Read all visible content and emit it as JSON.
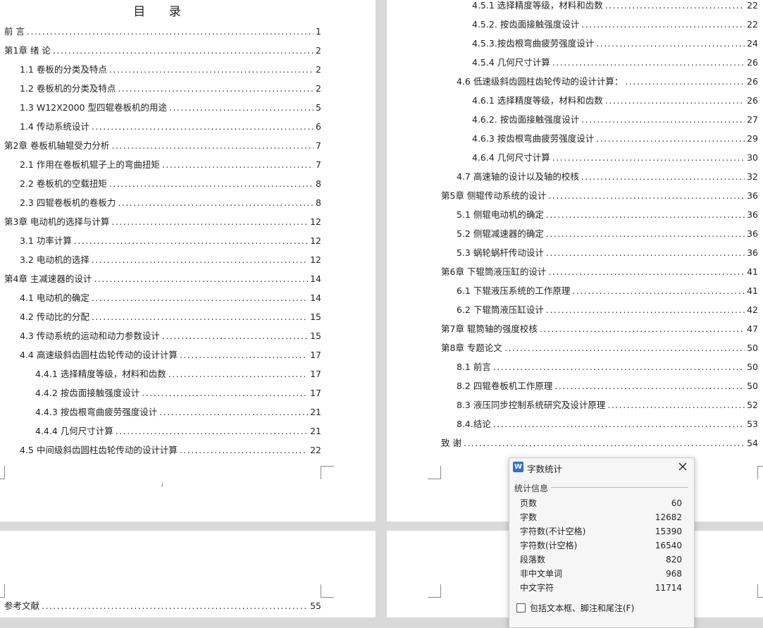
{
  "toc": {
    "title": "目 录",
    "left_entries": [
      {
        "text": "前 言",
        "page": "1",
        "level": 0
      },
      {
        "text": "第1章  绪   论",
        "page": "2",
        "level": 0
      },
      {
        "text": "1.1 卷板的分类及特点",
        "page": "2",
        "level": 1
      },
      {
        "text": "1.2 卷板机的分类及特点",
        "page": "2",
        "level": 1
      },
      {
        "text": "1.3 W12X2000 型四辊卷板机的用途",
        "page": "5",
        "level": 1
      },
      {
        "text": "1.4 传动系统设计",
        "page": "6",
        "level": 1
      },
      {
        "text": "第2章  卷板机轴辊受力分析",
        "page": "7",
        "level": 0
      },
      {
        "text": "2.1 作用在卷板机辊子上的弯曲扭矩",
        "page": "7",
        "level": 1
      },
      {
        "text": "2.2 卷板机的空载扭矩",
        "page": "8",
        "level": 1
      },
      {
        "text": "2.3 四辊卷板机的卷板力",
        "page": "8",
        "level": 1
      },
      {
        "text": "第3章  电动机的选择与计算",
        "page": "12",
        "level": 0
      },
      {
        "text": "3.1 功率计算",
        "page": "12",
        "level": 1
      },
      {
        "text": "3.2 电动机的选择",
        "page": "12",
        "level": 1
      },
      {
        "text": "第4章 主减速器的设计",
        "page": "14",
        "level": 0
      },
      {
        "text": "4.1 电动机的确定",
        "page": "14",
        "level": 1
      },
      {
        "text": "4.2 传动比的分配",
        "page": "15",
        "level": 1
      },
      {
        "text": "4.3 传动系统的运动和动力参数设计",
        "page": "15",
        "level": 1
      },
      {
        "text": "4.4 高速级斜齿圆柱齿轮传动的设计计算",
        "page": "17",
        "level": 1
      },
      {
        "text": "4.4.1 选择精度等级，材料和齿数",
        "page": "17",
        "level": 2
      },
      {
        "text": "4.4.2 按齿面接触强度设计",
        "page": "17",
        "level": 2
      },
      {
        "text": "4.4.3 按齿根弯曲疲劳强度设计",
        "page": "21",
        "level": 2
      },
      {
        "text": "4.4.4 几何尺寸计算",
        "page": "21",
        "level": 2
      },
      {
        "text": "4.5 中间级斜齿圆柱齿轮传动的设计计算",
        "page": "22",
        "level": 1
      }
    ],
    "right_entries": [
      {
        "text": "4.5.1 选择精度等级，材料和齿数",
        "page": "22",
        "level": 2
      },
      {
        "text": "4.5.2.  按齿面接触强度设计",
        "page": "22",
        "level": 2
      },
      {
        "text": "4.5.3.按齿根弯曲疲劳强度设计",
        "page": "24",
        "level": 2
      },
      {
        "text": "4.5.4 几何尺寸计算",
        "page": "26",
        "level": 2
      },
      {
        "text": "4.6  低速级斜齿圆柱齿轮传动的设计计算：",
        "page": "26",
        "level": 1
      },
      {
        "text": "4.6.1 选择精度等级，材料和齿数",
        "page": "26",
        "level": 2
      },
      {
        "text": "4.6.2.  按齿面接触强度设计",
        "page": "27",
        "level": 2
      },
      {
        "text": "4.6.3 按齿根弯曲疲劳强度设计",
        "page": "29",
        "level": 2
      },
      {
        "text": "4.6.4 几何尺寸计算",
        "page": "30",
        "level": 2
      },
      {
        "text": "4.7 高速轴的设计以及轴的校核",
        "page": "32",
        "level": 1
      },
      {
        "text": "第5章 侧辊传动系统的设计",
        "page": "36",
        "level": 0
      },
      {
        "text": "5.1 侧辊电动机的确定",
        "page": "36",
        "level": 1
      },
      {
        "text": "5.2 侧辊减速器的确定",
        "page": "36",
        "level": 1
      },
      {
        "text": "5.3 蜗轮蜗杆传动设计",
        "page": "36",
        "level": 1
      },
      {
        "text": "第6章 下辊筒液压缸的设计",
        "page": "41",
        "level": 0
      },
      {
        "text": "6.1 下辊液压系统的工作原理",
        "page": "41",
        "level": 1
      },
      {
        "text": "6.2 下辊筒液压缸设计",
        "page": "42",
        "level": 1
      },
      {
        "text": "第7章  辊筒轴的强度校核",
        "page": "47",
        "level": 0
      },
      {
        "text": "第8章  专题论文",
        "page": "50",
        "level": 0
      },
      {
        "text": "8.1 前言",
        "page": "50",
        "level": 1
      },
      {
        "text": "8.2 四辊卷板机工作原理",
        "page": "50",
        "level": 1
      },
      {
        "text": "8.3 液压同步控制系统研究及设计原理",
        "page": "52",
        "level": 1
      },
      {
        "text": "8.4.结论",
        "page": "53",
        "level": 1
      },
      {
        "text": "致   谢",
        "page": "54",
        "level": 0
      }
    ],
    "bottom_entry": {
      "text": "参考文献",
      "page": "55"
    },
    "footer_page_number": "i"
  },
  "word_count_dialog": {
    "title": "字数统计",
    "logo_letter": "W",
    "section_label": "统计信息",
    "rows": [
      {
        "label": "页数",
        "value": "60"
      },
      {
        "label": "字数",
        "value": "12682"
      },
      {
        "label": "字符数(不计空格)",
        "value": "15390"
      },
      {
        "label": "字符数(计空格)",
        "value": "16540"
      },
      {
        "label": "段落数",
        "value": "820"
      },
      {
        "label": "非中文单词",
        "value": "968"
      },
      {
        "label": "中文字符",
        "value": "11714"
      }
    ],
    "checkbox_label": "包括文本框、脚注和尾注(F)",
    "checkbox_checked": false
  },
  "colors": {
    "workspace": "#d9d9d9",
    "page": "#ffffff",
    "logo": "#2f6fd6"
  }
}
